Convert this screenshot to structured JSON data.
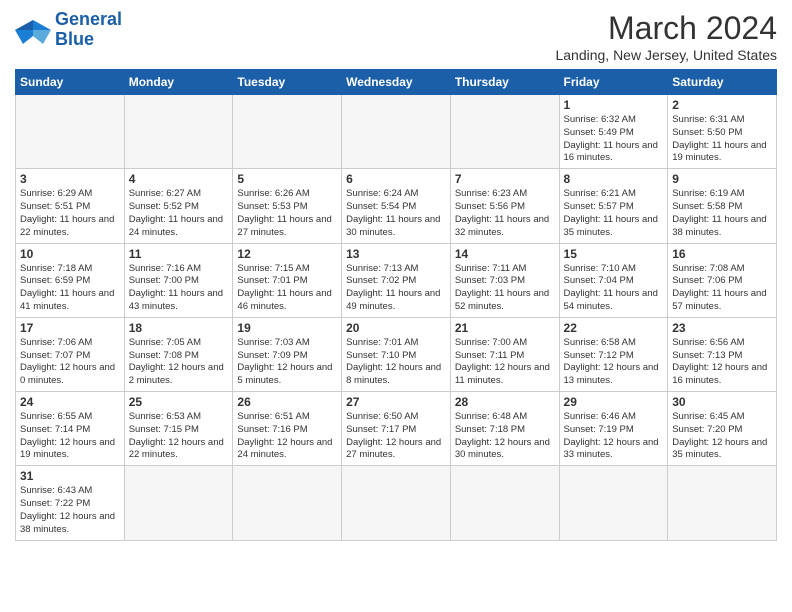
{
  "header": {
    "logo_line1": "General",
    "logo_line2": "Blue",
    "month_title": "March 2024",
    "location": "Landing, New Jersey, United States"
  },
  "weekdays": [
    "Sunday",
    "Monday",
    "Tuesday",
    "Wednesday",
    "Thursday",
    "Friday",
    "Saturday"
  ],
  "weeks": [
    [
      {
        "day": "",
        "info": ""
      },
      {
        "day": "",
        "info": ""
      },
      {
        "day": "",
        "info": ""
      },
      {
        "day": "",
        "info": ""
      },
      {
        "day": "",
        "info": ""
      },
      {
        "day": "1",
        "info": "Sunrise: 6:32 AM\nSunset: 5:49 PM\nDaylight: 11 hours and 16 minutes."
      },
      {
        "day": "2",
        "info": "Sunrise: 6:31 AM\nSunset: 5:50 PM\nDaylight: 11 hours and 19 minutes."
      }
    ],
    [
      {
        "day": "3",
        "info": "Sunrise: 6:29 AM\nSunset: 5:51 PM\nDaylight: 11 hours and 22 minutes."
      },
      {
        "day": "4",
        "info": "Sunrise: 6:27 AM\nSunset: 5:52 PM\nDaylight: 11 hours and 24 minutes."
      },
      {
        "day": "5",
        "info": "Sunrise: 6:26 AM\nSunset: 5:53 PM\nDaylight: 11 hours and 27 minutes."
      },
      {
        "day": "6",
        "info": "Sunrise: 6:24 AM\nSunset: 5:54 PM\nDaylight: 11 hours and 30 minutes."
      },
      {
        "day": "7",
        "info": "Sunrise: 6:23 AM\nSunset: 5:56 PM\nDaylight: 11 hours and 32 minutes."
      },
      {
        "day": "8",
        "info": "Sunrise: 6:21 AM\nSunset: 5:57 PM\nDaylight: 11 hours and 35 minutes."
      },
      {
        "day": "9",
        "info": "Sunrise: 6:19 AM\nSunset: 5:58 PM\nDaylight: 11 hours and 38 minutes."
      }
    ],
    [
      {
        "day": "10",
        "info": "Sunrise: 7:18 AM\nSunset: 6:59 PM\nDaylight: 11 hours and 41 minutes."
      },
      {
        "day": "11",
        "info": "Sunrise: 7:16 AM\nSunset: 7:00 PM\nDaylight: 11 hours and 43 minutes."
      },
      {
        "day": "12",
        "info": "Sunrise: 7:15 AM\nSunset: 7:01 PM\nDaylight: 11 hours and 46 minutes."
      },
      {
        "day": "13",
        "info": "Sunrise: 7:13 AM\nSunset: 7:02 PM\nDaylight: 11 hours and 49 minutes."
      },
      {
        "day": "14",
        "info": "Sunrise: 7:11 AM\nSunset: 7:03 PM\nDaylight: 11 hours and 52 minutes."
      },
      {
        "day": "15",
        "info": "Sunrise: 7:10 AM\nSunset: 7:04 PM\nDaylight: 11 hours and 54 minutes."
      },
      {
        "day": "16",
        "info": "Sunrise: 7:08 AM\nSunset: 7:06 PM\nDaylight: 11 hours and 57 minutes."
      }
    ],
    [
      {
        "day": "17",
        "info": "Sunrise: 7:06 AM\nSunset: 7:07 PM\nDaylight: 12 hours and 0 minutes."
      },
      {
        "day": "18",
        "info": "Sunrise: 7:05 AM\nSunset: 7:08 PM\nDaylight: 12 hours and 2 minutes."
      },
      {
        "day": "19",
        "info": "Sunrise: 7:03 AM\nSunset: 7:09 PM\nDaylight: 12 hours and 5 minutes."
      },
      {
        "day": "20",
        "info": "Sunrise: 7:01 AM\nSunset: 7:10 PM\nDaylight: 12 hours and 8 minutes."
      },
      {
        "day": "21",
        "info": "Sunrise: 7:00 AM\nSunset: 7:11 PM\nDaylight: 12 hours and 11 minutes."
      },
      {
        "day": "22",
        "info": "Sunrise: 6:58 AM\nSunset: 7:12 PM\nDaylight: 12 hours and 13 minutes."
      },
      {
        "day": "23",
        "info": "Sunrise: 6:56 AM\nSunset: 7:13 PM\nDaylight: 12 hours and 16 minutes."
      }
    ],
    [
      {
        "day": "24",
        "info": "Sunrise: 6:55 AM\nSunset: 7:14 PM\nDaylight: 12 hours and 19 minutes."
      },
      {
        "day": "25",
        "info": "Sunrise: 6:53 AM\nSunset: 7:15 PM\nDaylight: 12 hours and 22 minutes."
      },
      {
        "day": "26",
        "info": "Sunrise: 6:51 AM\nSunset: 7:16 PM\nDaylight: 12 hours and 24 minutes."
      },
      {
        "day": "27",
        "info": "Sunrise: 6:50 AM\nSunset: 7:17 PM\nDaylight: 12 hours and 27 minutes."
      },
      {
        "day": "28",
        "info": "Sunrise: 6:48 AM\nSunset: 7:18 PM\nDaylight: 12 hours and 30 minutes."
      },
      {
        "day": "29",
        "info": "Sunrise: 6:46 AM\nSunset: 7:19 PM\nDaylight: 12 hours and 33 minutes."
      },
      {
        "day": "30",
        "info": "Sunrise: 6:45 AM\nSunset: 7:20 PM\nDaylight: 12 hours and 35 minutes."
      }
    ],
    [
      {
        "day": "31",
        "info": "Sunrise: 6:43 AM\nSunset: 7:22 PM\nDaylight: 12 hours and 38 minutes."
      },
      {
        "day": "",
        "info": ""
      },
      {
        "day": "",
        "info": ""
      },
      {
        "day": "",
        "info": ""
      },
      {
        "day": "",
        "info": ""
      },
      {
        "day": "",
        "info": ""
      },
      {
        "day": "",
        "info": ""
      }
    ]
  ]
}
